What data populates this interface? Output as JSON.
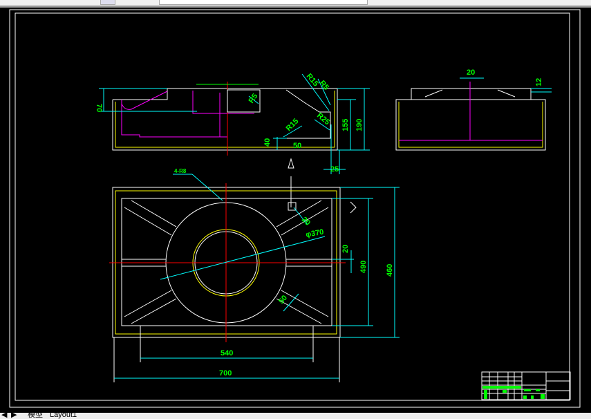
{
  "tabs": {
    "model": "模型",
    "layout": "Layout1"
  },
  "colors": {
    "background": "#000000",
    "outline": "#ffffff",
    "dimension": "#00ffff",
    "text": "#00ff00",
    "hidden": "#ff00ff",
    "center": "#ff0000",
    "inner": "#ffff00"
  },
  "drawing": {
    "front_view": {
      "dims": [
        "70",
        "R5",
        "40",
        "50",
        "R15",
        "R5",
        "R15",
        "R25",
        "155",
        "190",
        "25"
      ]
    },
    "side_view": {
      "dims": [
        "20",
        "12"
      ]
    },
    "plan_view": {
      "dims": [
        "4-R8",
        "20",
        "φ370",
        "20",
        "490",
        "460",
        "50",
        "540",
        "700"
      ]
    }
  }
}
